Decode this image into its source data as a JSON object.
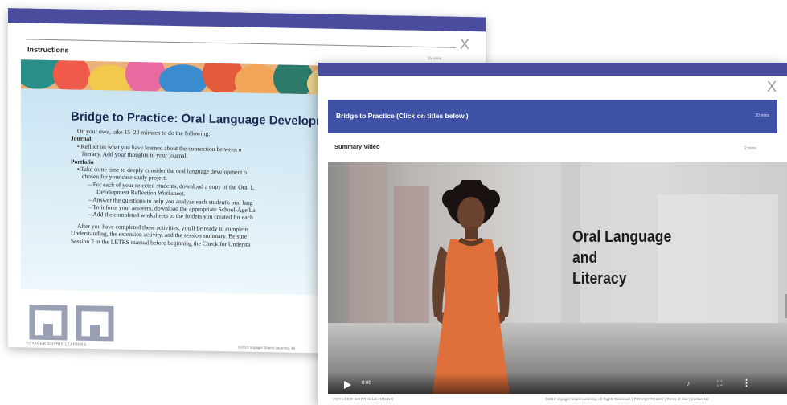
{
  "back_window": {
    "close_label": "X",
    "header_title": "Instructions",
    "header_time": "15 mins",
    "heading": "Bridge to Practice: Oral Language Developme",
    "body_lines": [
      "On your own, take 15–20 minutes to do the following:",
      "Journal",
      "• Reflect on what you have learned about the connection between o",
      "literacy. Add your thoughts to your journal.",
      "Portfolio",
      "• Take some time to deeply consider the oral language development o",
      "chosen for your case study project.",
      "– For each of your selected students, download a copy of the Oral L",
      "Development Reflection Worksheet.",
      "– Answer the questions to help you analyze each student's oral lang",
      "– To inform your answers, download the appropriate School-Age La",
      "– Add the completed worksheets to the folders you created for each",
      "After you have completed these activities, you'll be ready to complete",
      "Understanding, the extension activity, and the session summary. Be sure",
      "Session 2 in the LETRS manual before beginning the Check for Understa"
    ],
    "brand": "VOYAGER SOPRIS LEARNING",
    "copyright": "©2019 Voyager Sopris Learning. All"
  },
  "front_window": {
    "close_label": "X",
    "header_title": "Bridge to Practice (Click on titles below.)",
    "header_time": "20 mins",
    "section_title": "Summary Video",
    "section_time": "2 mins",
    "video": {
      "caption_lines": [
        "Oral Language",
        "and",
        "Literacy"
      ],
      "current_time": "0:00",
      "play_icon": "play-icon",
      "volume_icon": "volume-icon",
      "fullscreen_icon": "fullscreen-icon",
      "more_icon": "more-options-icon"
    },
    "brand": "VOYAGER SOPRIS LEARNING",
    "copyright": "©2019 Voyager Sopris Learning. All Rights Reserved. | PRIVACY POLICY | Terms of Use | Contact Us"
  },
  "colors": {
    "window_bar": "#4a4c9e",
    "blue_header": "#3f51a5",
    "dress": "#e0703b"
  }
}
